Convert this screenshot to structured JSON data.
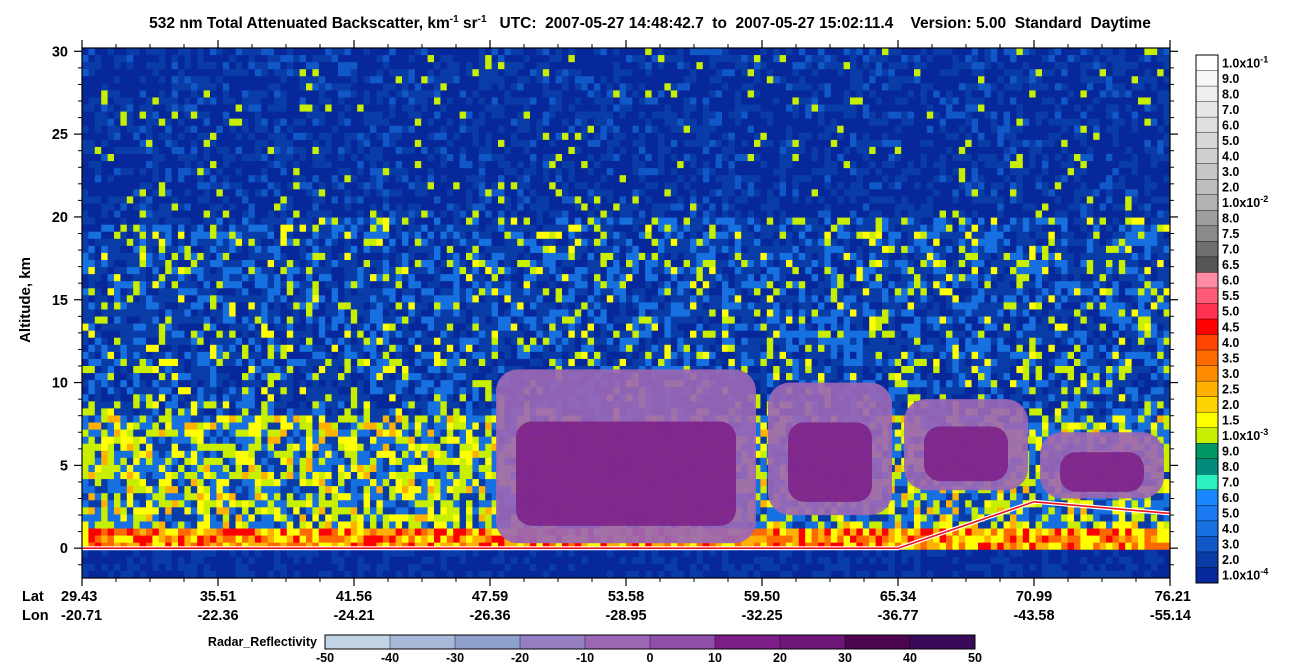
{
  "title": {
    "main": "532 nm Total Attenuated Backscatter, km",
    "exp1": "-1",
    "sr": " sr",
    "exp2": "-1",
    "tail": "   UTC:  2007-05-27 14:48:42.7  to  2007-05-27 15:02:11.4    Version: 5.00  Standard  Daytime"
  },
  "axes": {
    "ylabel": "Altitude, km",
    "lat_label": "Lat",
    "lon_label": "Lon"
  },
  "chart_data": {
    "type": "heatmap",
    "title": "532 nm Total Attenuated Backscatter, km-1 sr-1",
    "utc_start": "2007-05-27 14:48:42.7",
    "utc_end": "2007-05-27 15:02:11.4",
    "version": "5.00",
    "product": "Standard",
    "mode": "Daytime",
    "ylabel": "Altitude, km",
    "ylim": [
      -1.8,
      30.2
    ],
    "yticks": [
      0,
      5,
      10,
      15,
      20,
      25,
      30
    ],
    "x_ticks": [
      {
        "lat": "29.43",
        "lon": "-20.71"
      },
      {
        "lat": "35.51",
        "lon": "-22.36"
      },
      {
        "lat": "41.56",
        "lon": "-24.21"
      },
      {
        "lat": "47.59",
        "lon": "-26.36"
      },
      {
        "lat": "53.58",
        "lon": "-28.95"
      },
      {
        "lat": "59.50",
        "lon": "-32.25"
      },
      {
        "lat": "65.34",
        "lon": "-36.77"
      },
      {
        "lat": "70.99",
        "lon": "-43.58"
      },
      {
        "lat": "76.21",
        "lon": "-55.14"
      }
    ],
    "colorbar": {
      "labels": [
        "1.0x10-1",
        "9.0",
        "8.0",
        "7.0",
        "6.0",
        "5.0",
        "4.0",
        "3.0",
        "2.0",
        "1.0x10-2",
        "8.0",
        "7.5",
        "7.0",
        "6.5",
        "6.0",
        "5.5",
        "5.0",
        "4.5",
        "4.0",
        "3.5",
        "3.0",
        "2.5",
        "2.0",
        "1.5",
        "1.0x10-3",
        "9.0",
        "8.0",
        "7.0",
        "6.0",
        "5.0",
        "4.0",
        "3.0",
        "2.0",
        "1.0x10-4"
      ],
      "colors": [
        "#ffffff",
        "#f7f7f7",
        "#efefef",
        "#e7e7e7",
        "#dfdfdf",
        "#d7d7d7",
        "#cfcfcf",
        "#c6c6c6",
        "#bdbdbd",
        "#b2b2b2",
        "#9e9e9e",
        "#8a8a8a",
        "#707070",
        "#555555",
        "#ff8aa5",
        "#ff5a78",
        "#ff3350",
        "#ff0000",
        "#ff4500",
        "#ff6a00",
        "#ff8c00",
        "#ffb000",
        "#ffd300",
        "#ffff00",
        "#c8ef00",
        "#009966",
        "#008b7a",
        "#2bf0c0",
        "#1a86ff",
        "#1a78f0",
        "#1670e0",
        "#1058c8",
        "#0a3ca8",
        "#06289a"
      ]
    },
    "radar_reflectivity": {
      "label": "Radar_Reflectivity",
      "ticks": [
        "-50",
        "-40",
        "-30",
        "-20",
        "-10",
        "0",
        "10",
        "20",
        "30",
        "40",
        "50"
      ],
      "colors": [
        "#c3d3e6",
        "#a7b8d8",
        "#8ea0cc",
        "#957fc2",
        "#9b67b5",
        "#8f4ea8",
        "#7d1d87",
        "#6e1678",
        "#4d0550",
        "#3a0a5a",
        "#3c1b8c"
      ]
    },
    "series": [
      {
        "name": "Radar_Reflectivity",
        "cloud_regions_km": [
          {
            "lat_from": "47.59",
            "lat_to": "59.50",
            "bottom": 0.3,
            "top": 10.8
          },
          {
            "lat_from": "59.50",
            "lat_to": "65.34",
            "bottom": 2.0,
            "top": 10.0
          },
          {
            "lat_from": "65.34",
            "lat_to": "70.99",
            "bottom": 3.5,
            "top": 9.0
          },
          {
            "lat_from": "70.99",
            "lat_to": "76.21",
            "bottom": 3.0,
            "top": 7.0
          }
        ]
      }
    ],
    "surface_elevation_line_km": [
      {
        "lat": "29.43",
        "alt": 0
      },
      {
        "lat": "65.34",
        "alt": 0
      },
      {
        "lat": "70.99",
        "alt": 2.8
      },
      {
        "lat": "76.21",
        "alt": 2.1
      }
    ]
  }
}
